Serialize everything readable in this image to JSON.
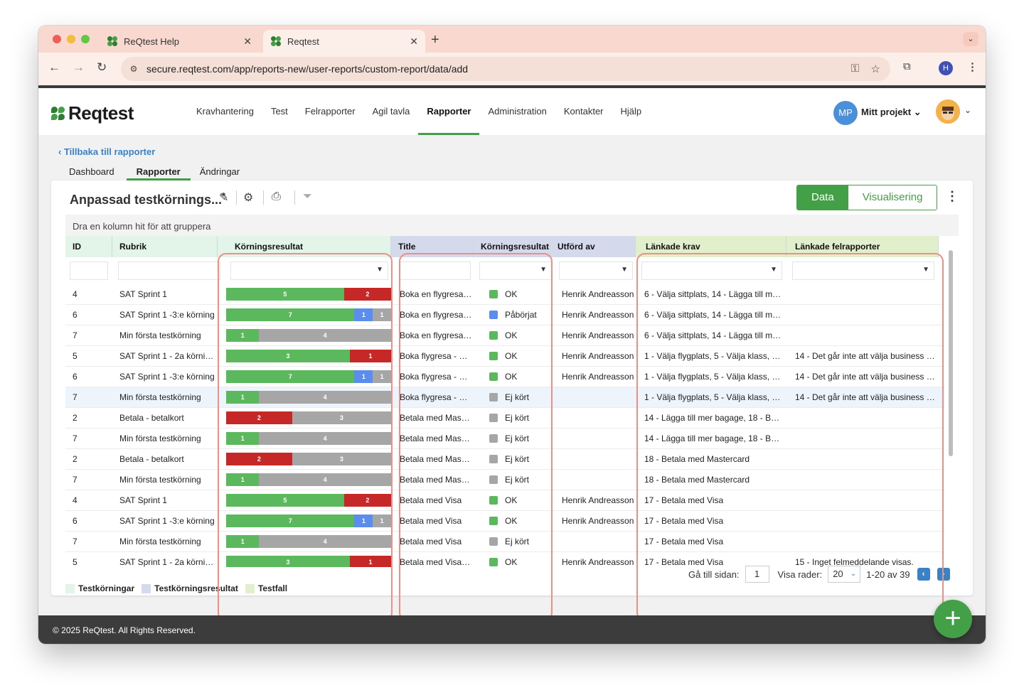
{
  "browser": {
    "tabs": [
      {
        "title": "ReQtest Help"
      },
      {
        "title": "Reqtest"
      }
    ],
    "url": "secure.reqtest.com/app/reports-new/user-reports/custom-report/data/add",
    "profile_initial": "H"
  },
  "app": {
    "logo": "Reqtest",
    "nav": [
      "Kravhantering",
      "Test",
      "Felrapporter",
      "Agil tavla",
      "Rapporter",
      "Administration",
      "Kontakter",
      "Hjälp"
    ],
    "active_nav": "Rapporter",
    "project_initials": "MP",
    "project_label": "Mitt projekt"
  },
  "page": {
    "back_link": "Tillbaka till rapporter",
    "subtabs": [
      "Dashboard",
      "Rapporter",
      "Ändringar"
    ],
    "report_title": "Anpassad testkörnings...",
    "title_marker": "*",
    "view_toggle": [
      "Data",
      "Visualisering"
    ],
    "group_hint": "Dra en kolumn hit för att gruppera"
  },
  "grid": {
    "columns": [
      "ID",
      "Rubrik",
      "Körningsresultat",
      "Title",
      "Körningsresultat",
      "Utförd av",
      "Länkade krav",
      "Länkade felrapporter"
    ],
    "colors": {
      "pass": "#5cb85c",
      "fail": "#c62828",
      "inprogress": "#5b8def",
      "notrun": "#a6a6a6"
    },
    "rows": [
      {
        "id": "4",
        "rubrik": "SAT Sprint 1",
        "bar": [
          [
            "pass",
            5
          ],
          [
            "fail",
            2
          ]
        ],
        "title": "Boka en flygresa -...",
        "status": "OK",
        "status_color": "pass",
        "by": "Henrik Andreasson",
        "krav": "6 - Välja sittplats, 14 - Lägga till mer ...",
        "fel": ""
      },
      {
        "id": "6",
        "rubrik": "SAT Sprint 1 -3:e körning",
        "bar": [
          [
            "pass",
            7
          ],
          [
            "inprogress",
            1
          ],
          [
            "notrun",
            1
          ]
        ],
        "title": "Boka en flygresa -...",
        "status": "Påbörjat",
        "status_color": "inprogress",
        "by": "Henrik Andreasson",
        "krav": "6 - Välja sittplats, 14 - Lägga till mer ...",
        "fel": ""
      },
      {
        "id": "7",
        "rubrik": "Min första testkörning",
        "bar": [
          [
            "pass",
            1
          ],
          [
            "notrun",
            4
          ]
        ],
        "title": "Boka en flygresa -...",
        "status": "OK",
        "status_color": "pass",
        "by": "Henrik Andreasson",
        "krav": "6 - Välja sittplats, 14 - Lägga till mer ...",
        "fel": ""
      },
      {
        "id": "5",
        "rubrik": "SAT Sprint 1 - 2a körninger",
        "bar": [
          [
            "pass",
            3
          ],
          [
            "fail",
            1
          ]
        ],
        "title": "Boka flygresa - Vä...",
        "status": "OK",
        "status_color": "pass",
        "by": "Henrik Andreasson",
        "krav": "1 - Välja flygplats, 5 - Välja klass, 14 -...",
        "fel": "14 - Det går inte att välja business cl..."
      },
      {
        "id": "6",
        "rubrik": "SAT Sprint 1 -3:e körning",
        "bar": [
          [
            "pass",
            7
          ],
          [
            "inprogress",
            1
          ],
          [
            "notrun",
            1
          ]
        ],
        "title": "Boka flygresa - Vä...",
        "status": "OK",
        "status_color": "pass",
        "by": "Henrik Andreasson",
        "krav": "1 - Välja flygplats, 5 - Välja klass, 14 -...",
        "fel": "14 - Det går inte att välja business cl..."
      },
      {
        "id": "7",
        "rubrik": "Min första testkörning",
        "bar": [
          [
            "pass",
            1
          ],
          [
            "notrun",
            4
          ]
        ],
        "title": "Boka flygresa - Vä...",
        "status": "Ej kört",
        "status_color": "notrun",
        "by": "",
        "krav": "1 - Välja flygplats, 5 - Välja klass, 14 -...",
        "fel": "14 - Det går inte att välja business cl..."
      },
      {
        "id": "2",
        "rubrik": "Betala - betalkort",
        "bar": [
          [
            "fail",
            2
          ],
          [
            "notrun",
            3
          ]
        ],
        "title": "Betala med Maste...",
        "status": "Ej kört",
        "status_color": "notrun",
        "by": "",
        "krav": "14 - Lägga till mer bagage, 18 - Betal...",
        "fel": ""
      },
      {
        "id": "7",
        "rubrik": "Min första testkörning",
        "bar": [
          [
            "pass",
            1
          ],
          [
            "notrun",
            4
          ]
        ],
        "title": "Betala med Maste...",
        "status": "Ej kört",
        "status_color": "notrun",
        "by": "",
        "krav": "14 - Lägga till mer bagage, 18 - Betal...",
        "fel": ""
      },
      {
        "id": "2",
        "rubrik": "Betala - betalkort",
        "bar": [
          [
            "fail",
            2
          ],
          [
            "notrun",
            3
          ]
        ],
        "title": "Betala med Maste...",
        "status": "Ej kört",
        "status_color": "notrun",
        "by": "",
        "krav": "18 - Betala med Mastercard",
        "fel": ""
      },
      {
        "id": "7",
        "rubrik": "Min första testkörning",
        "bar": [
          [
            "pass",
            1
          ],
          [
            "notrun",
            4
          ]
        ],
        "title": "Betala med Maste...",
        "status": "Ej kört",
        "status_color": "notrun",
        "by": "",
        "krav": "18 - Betala med Mastercard",
        "fel": ""
      },
      {
        "id": "4",
        "rubrik": "SAT Sprint 1",
        "bar": [
          [
            "pass",
            5
          ],
          [
            "fail",
            2
          ]
        ],
        "title": "Betala med Visa",
        "status": "OK",
        "status_color": "pass",
        "by": "Henrik Andreasson",
        "krav": "17 - Betala med Visa",
        "fel": ""
      },
      {
        "id": "6",
        "rubrik": "SAT Sprint 1 -3:e körning",
        "bar": [
          [
            "pass",
            7
          ],
          [
            "inprogress",
            1
          ],
          [
            "notrun",
            1
          ]
        ],
        "title": "Betala med Visa",
        "status": "OK",
        "status_color": "pass",
        "by": "Henrik Andreasson",
        "krav": "17 - Betala med Visa",
        "fel": ""
      },
      {
        "id": "7",
        "rubrik": "Min första testkörning",
        "bar": [
          [
            "pass",
            1
          ],
          [
            "notrun",
            4
          ]
        ],
        "title": "Betala med Visa",
        "status": "Ej kört",
        "status_color": "notrun",
        "by": "",
        "krav": "17 - Betala med Visa",
        "fel": ""
      },
      {
        "id": "5",
        "rubrik": "SAT Sprint 1 - 2a körninger",
        "bar": [
          [
            "pass",
            3
          ],
          [
            "fail",
            1
          ]
        ],
        "title": "Betala med Visa - ...",
        "status": "OK",
        "status_color": "pass",
        "by": "Henrik Andreasson",
        "krav": "17 - Betala med Visa",
        "fel": "15 - Inget felmeddelande visas."
      }
    ],
    "selected_row": 5
  },
  "legend": [
    {
      "label": "Testkörningar",
      "color": "#e3f4e8"
    },
    {
      "label": "Testkörningsresultat",
      "color": "#d5d9ec"
    },
    {
      "label": "Testfall",
      "color": "#e1efcc"
    }
  ],
  "pager": {
    "goto_label": "Gå till sidan:",
    "page": "1",
    "rows_label": "Visa rader:",
    "rows": "20",
    "range": "1-20 av 39"
  },
  "footer": "© 2025 ReQtest. All Rights Reserved."
}
